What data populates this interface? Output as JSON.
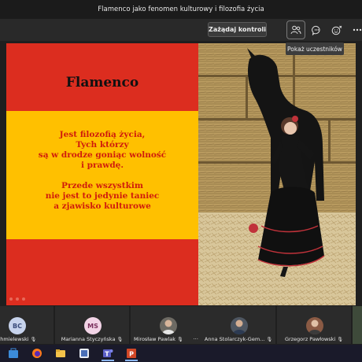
{
  "window": {
    "title": "Flamenco jako fenomen kulturowy i filozofia życia"
  },
  "toolbar": {
    "request_control_label": "Zażądaj kontroli",
    "icons": [
      "participants-icon",
      "chat-icon",
      "reactions-icon",
      "more-options-icon"
    ],
    "tooltip_label": "Pokaż uczestników"
  },
  "slide": {
    "title": "Flamenco",
    "lines": [
      "Jest filozofią życia,",
      "Tych którzy",
      "są w drodze goniąc wolność",
      "i prawdę.",
      "",
      "Przede wszystkim",
      "nie jest to jedynie taniec",
      "a zjawisko kulturowe"
    ],
    "colors": {
      "red": "#dc2d1f",
      "yellow": "#ffc000",
      "text_red": "#d01c0c"
    }
  },
  "participants": [
    {
      "name": "Chmielewski",
      "initials": "BC",
      "avatar_color": "#c7d3ec",
      "kind": "initials"
    },
    {
      "name": "Marianna Styczyńska",
      "initials": "MS",
      "avatar_color": "#f2d4e6",
      "kind": "initials"
    },
    {
      "name": "Mirosław Pawlak",
      "initials": "",
      "avatar_color": "#6d6a63",
      "kind": "photo"
    },
    {
      "name": "Anna Stolarczyk-Gem...",
      "initials": "",
      "avatar_color": "#4e5661",
      "kind": "photo"
    },
    {
      "name": "Grzegorz Pawłowski",
      "initials": "",
      "avatar_color": "#8a5a44",
      "kind": "photo"
    }
  ],
  "taskbar": {
    "apps": [
      "windows-store-icon",
      "firefox-icon",
      "file-explorer-icon",
      "media-app-icon",
      "teams-icon",
      "powerpoint-icon"
    ]
  }
}
